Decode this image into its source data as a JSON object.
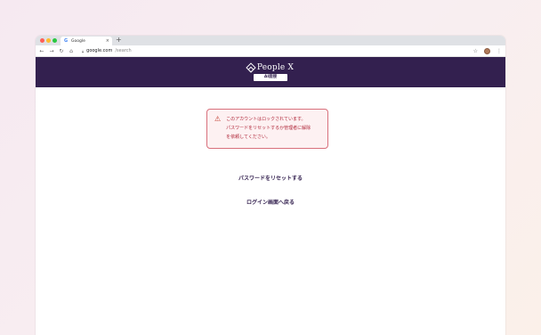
{
  "browser": {
    "tab_icon": "G",
    "tab_title": "Google",
    "tab_close": "×",
    "new_tab": "+",
    "url_host": "google.com",
    "url_path": "/search"
  },
  "header": {
    "brand_name": "People X",
    "badge": "AI面接",
    "bg_color": "#33204f"
  },
  "alert": {
    "icon": "warning-triangle-icon",
    "message_lines": [
      "このアカウントはロックされています。",
      "パスワードをリセットするか管理者に解除",
      "を依頼してください。"
    ],
    "color": "#b0283a"
  },
  "links": {
    "reset_password": "パスワードをリセットする",
    "back_to_login": "ログイン画面へ戻る"
  }
}
